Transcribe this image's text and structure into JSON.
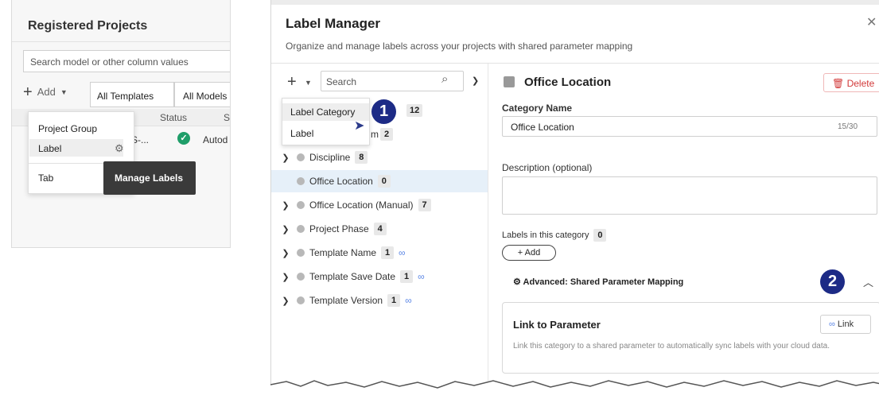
{
  "registered_projects": {
    "title": "Registered Projects",
    "search_placeholder": "Search model or other column values",
    "add_label": "Add",
    "templates_filter": "All Templates",
    "models_filter": "All Models",
    "columns": {
      "status": "Status",
      "s": "S"
    },
    "row": {
      "name_partial": "S-...",
      "autod": "Autod"
    },
    "add_menu": {
      "items": [
        "Project Group",
        "Label",
        "Tab"
      ]
    },
    "tooltip": "Manage Labels"
  },
  "label_manager": {
    "title": "Label Manager",
    "subtitle": "Organize and manage labels across your projects with shared parameter mapping",
    "search_placeholder": "Search",
    "context_menu": {
      "items": [
        "Label Category",
        "Label"
      ]
    },
    "callouts": [
      "1",
      "2"
    ],
    "hidden_row": {
      "suffix": "m",
      "count": "2",
      "top_count": "12"
    },
    "tree": [
      {
        "name": "Discipline",
        "count": "8",
        "expandable": true,
        "linked": false
      },
      {
        "name": "Office Location",
        "count": "0",
        "expandable": false,
        "linked": false,
        "selected": true
      },
      {
        "name": "Office Location (Manual)",
        "count": "7",
        "expandable": true,
        "linked": false
      },
      {
        "name": "Project Phase",
        "count": "4",
        "expandable": true,
        "linked": false
      },
      {
        "name": "Template Name",
        "count": "1",
        "expandable": true,
        "linked": true
      },
      {
        "name": "Template Save Date",
        "count": "1",
        "expandable": true,
        "linked": true
      },
      {
        "name": "Template Version",
        "count": "1",
        "expandable": true,
        "linked": true
      }
    ],
    "detail": {
      "title": "Office Location",
      "delete_label": "Delete",
      "category_name_label": "Category Name",
      "category_name_value": "Office Location",
      "char_count": "15/30",
      "description_label": "Description (optional)",
      "labels_in_category_label": "Labels in this category",
      "labels_in_category_count": "0",
      "add_button": "+ Add",
      "advanced_label": "Advanced: Shared Parameter Mapping",
      "link_card": {
        "title": "Link to Parameter",
        "button": "Link",
        "description": "Link this category to a shared parameter to automatically sync labels with your cloud data."
      }
    }
  },
  "colors": {
    "callout": "#1d2b86",
    "selected_row": "#e6f0f9",
    "status_ok": "#1f9e69",
    "delete": "#d23a3a",
    "link": "#5b86e5"
  }
}
